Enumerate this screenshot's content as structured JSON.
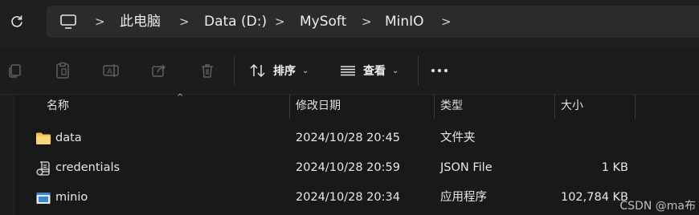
{
  "address_bar": {
    "crumbs": [
      "此电脑",
      "Data (D:)",
      "MySoft",
      "MinIO"
    ]
  },
  "toolbar": {
    "sort_label": "排序",
    "view_label": "查看"
  },
  "columns": {
    "name": "名称",
    "modified": "修改日期",
    "type": "类型",
    "size": "大小"
  },
  "files": [
    {
      "name": "data",
      "modified": "2024/10/28 20:45",
      "type": "文件夹",
      "size": "",
      "icon": "folder-icon"
    },
    {
      "name": "credentials",
      "modified": "2024/10/28 20:59",
      "type": "JSON File",
      "size": "1 KB",
      "icon": "json-file-icon"
    },
    {
      "name": "minio",
      "modified": "2024/10/28 20:34",
      "type": "应用程序",
      "size": "102,784 KB",
      "icon": "application-icon"
    }
  ],
  "watermark": "CSDN @ma布",
  "colors": {
    "background": "#191919",
    "address_bar": "#2b2b2b",
    "folder": "#f2c14e",
    "app_icon": "#3a86d4"
  }
}
